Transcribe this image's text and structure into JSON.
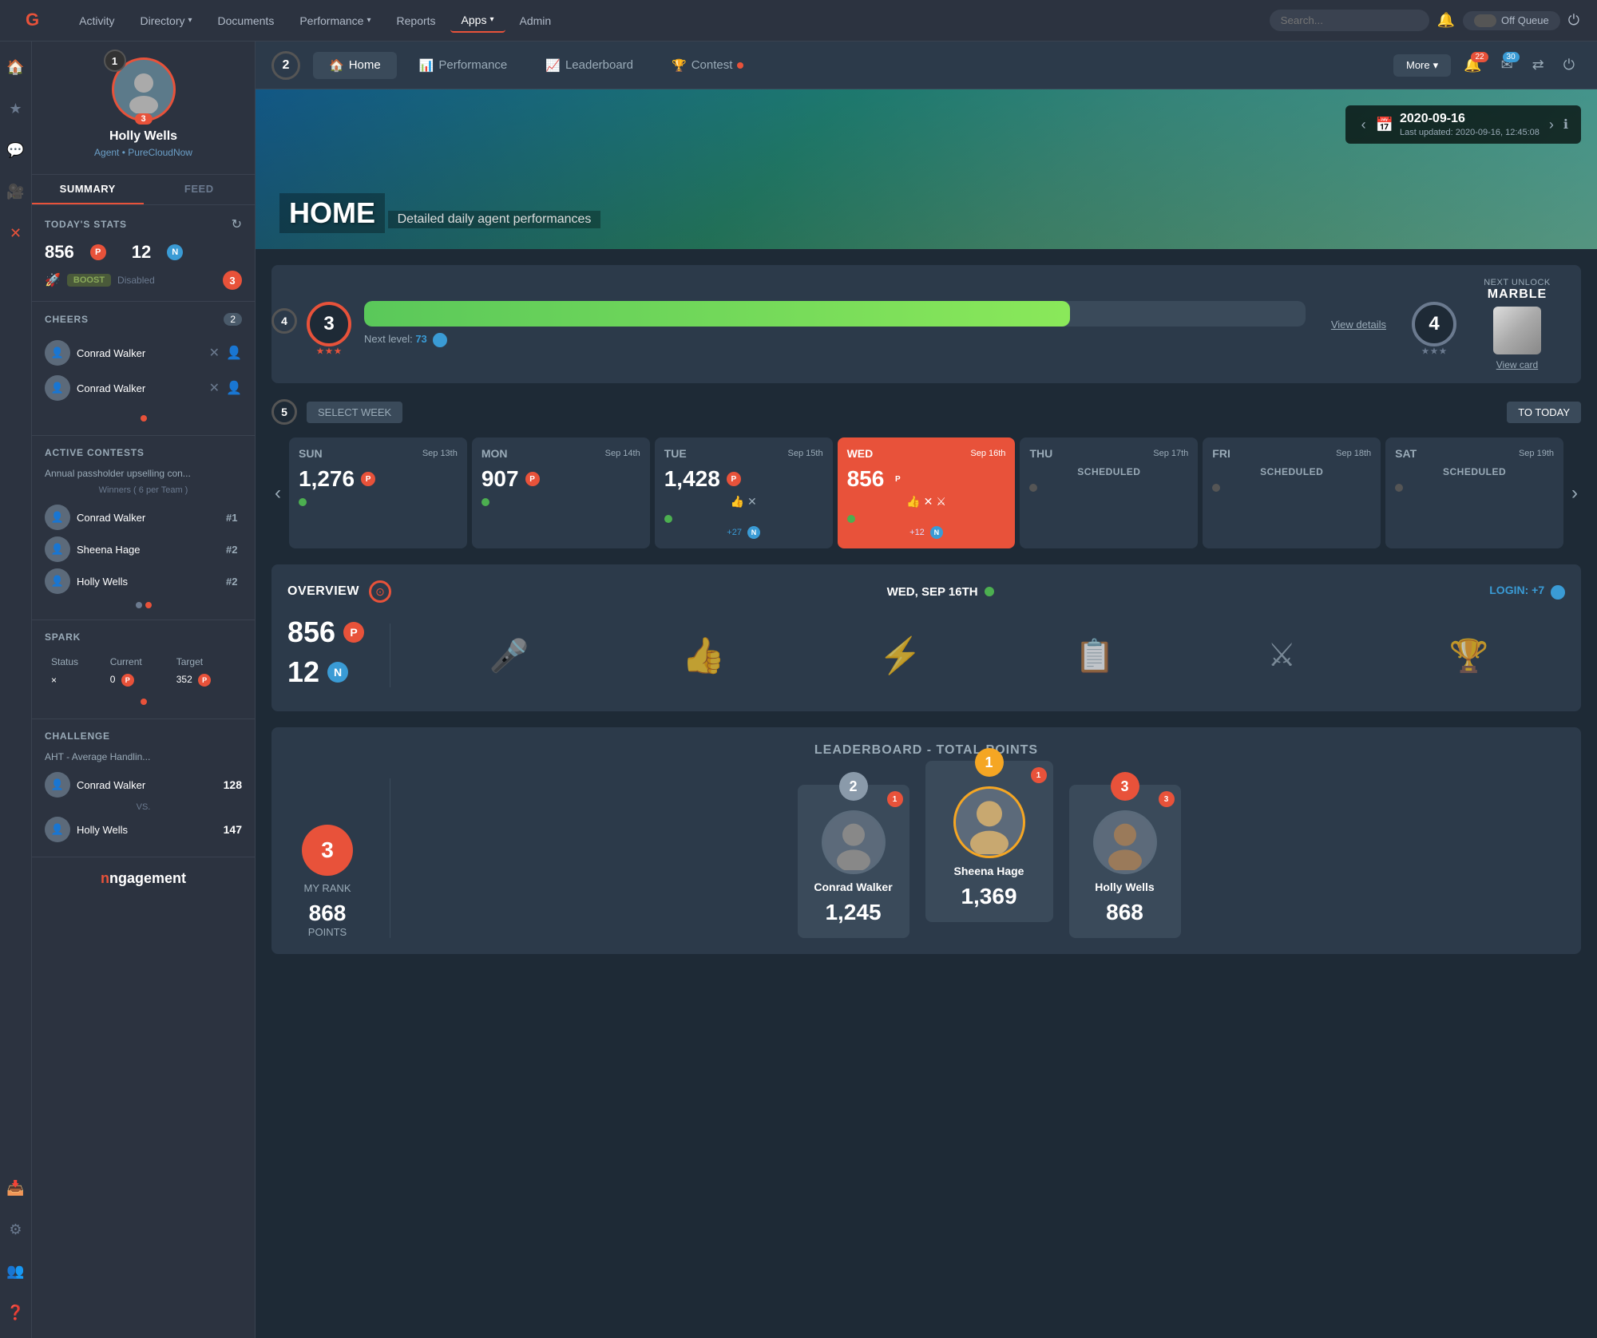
{
  "topNav": {
    "logo": "G",
    "items": [
      {
        "label": "Activity",
        "active": false
      },
      {
        "label": "Directory",
        "active": false,
        "hasChevron": true
      },
      {
        "label": "Documents",
        "active": false
      },
      {
        "label": "Performance",
        "active": false,
        "hasChevron": true
      },
      {
        "label": "Reports",
        "active": false
      },
      {
        "label": "Apps",
        "active": true,
        "hasChevron": true
      },
      {
        "label": "Admin",
        "active": false
      }
    ],
    "searchPlaceholder": "Search...",
    "queueLabel": "Off Queue",
    "notifCount": "22",
    "mailCount": "30"
  },
  "leftSidebar": {
    "icons": [
      "home",
      "star",
      "chat",
      "video",
      "ban",
      "inbox",
      "settings",
      "user-group",
      "question"
    ]
  },
  "userPanel": {
    "stepNum": "1",
    "name": "Holly Wells",
    "role": "Agent • PureCloudNow",
    "level": "3",
    "tabs": [
      "SUMMARY",
      "FEED"
    ],
    "activeTab": "SUMMARY",
    "todaysStats": {
      "title": "TODAY'S STATS",
      "points": "856",
      "nPoints": "12",
      "boostLabel": "BOOST",
      "boostStatus": "Disabled",
      "boostNum": "3"
    },
    "cheers": {
      "title": "CHEERS",
      "count": "2",
      "items": [
        {
          "name": "Conrad Walker"
        },
        {
          "name": "Conrad Walker"
        }
      ]
    },
    "activeContests": {
      "title": "ACTIVE CONTESTS",
      "name": "Annual passholder upselling con...",
      "winnersLabel": "Winners ( 6 per Team )",
      "ranks": [
        {
          "name": "Conrad Walker",
          "rank": "#1"
        },
        {
          "name": "Sheena Hage",
          "rank": "#2"
        },
        {
          "name": "Holly Wells",
          "rank": "#2"
        }
      ]
    },
    "spark": {
      "title": "SPARK",
      "status": "×",
      "current": "0",
      "target": "352",
      "currentLabel": "Current",
      "targetLabel": "Target",
      "statusLabel": "Status"
    },
    "challenge": {
      "title": "CHALLENGE",
      "name": "AHT - Average Handlin...",
      "players": [
        {
          "name": "Conrad Walker",
          "score": "128"
        },
        {
          "name": "Holly Wells",
          "score": "147"
        }
      ]
    },
    "brand": "ngagement"
  },
  "secondNav": {
    "stepNum": "2",
    "tabs": [
      {
        "label": "Home",
        "icon": "🏠",
        "active": true
      },
      {
        "label": "Performance",
        "icon": "📊",
        "active": false
      },
      {
        "label": "Leaderboard",
        "icon": "📈",
        "active": false
      },
      {
        "label": "Contest",
        "icon": "🏆",
        "active": false
      }
    ],
    "moreLabel": "More",
    "notifCount": "22",
    "mailCount": "30"
  },
  "hero": {
    "title": "HOME",
    "subtitle": "Detailed daily agent performances",
    "date": "2020-09-16",
    "lastUpdated": "Last updated: 2020-09-16, 12:45:08"
  },
  "levelProgress": {
    "stepNum4": "4",
    "currentLevel": "3",
    "nextLevel": "4",
    "nextLevelPoints": "73",
    "progressPercent": 75,
    "viewDetailsLabel": "View details",
    "nextUnlockLabel": "NEXT UNLOCK",
    "nextUnlockItem": "MARBLE",
    "viewCardLabel": "View card"
  },
  "weekSelector": {
    "stepNum5": "5",
    "selectWeekLabel": "SELECT WEEK",
    "toTodayLabel": "TO TODAY",
    "days": [
      {
        "name": "SUN",
        "date": "Sep 13th",
        "points": "1,276",
        "hasDot": true,
        "dotColor": "green",
        "active": false,
        "status": null,
        "bonus": null
      },
      {
        "name": "MON",
        "date": "Sep 14th",
        "points": "907",
        "hasDot": true,
        "dotColor": "green",
        "active": false,
        "status": null,
        "bonus": null
      },
      {
        "name": "TUE",
        "date": "Sep 15th",
        "points": "1,428",
        "hasDot": true,
        "dotColor": "green",
        "active": false,
        "status": null,
        "bonus": "+27",
        "hasActions": true
      },
      {
        "name": "WED",
        "date": "Sep 16th",
        "points": "856",
        "hasDot": true,
        "dotColor": "green",
        "active": true,
        "status": null,
        "bonus": "+12",
        "hasActions": true
      },
      {
        "name": "THU",
        "date": "Sep 17th",
        "points": null,
        "hasDot": false,
        "dotColor": "gray",
        "active": false,
        "status": "SCHEDULED",
        "bonus": null
      },
      {
        "name": "FRI",
        "date": "Sep 18th",
        "points": null,
        "hasDot": false,
        "dotColor": "gray",
        "active": false,
        "status": "SCHEDULED",
        "bonus": null
      },
      {
        "name": "SAT",
        "date": "Sep 19th",
        "points": null,
        "hasDot": false,
        "dotColor": "gray",
        "active": false,
        "status": "SCHEDULED",
        "bonus": null
      }
    ]
  },
  "overview": {
    "title": "OVERVIEW",
    "date": "WED, SEP 16TH",
    "loginLabel": "LOGIN:",
    "loginBonus": "+7",
    "points": "856",
    "nPoints": "12",
    "icons": [
      "👍",
      "⚡",
      "📋",
      "⚔",
      "🏆"
    ]
  },
  "leaderboard": {
    "title": "LEADERBOARD - TOTAL POINTS",
    "myRank": "3",
    "myPoints": "868",
    "myPointsLabel": "POINTS",
    "myRankLabel": "MY RANK",
    "players": [
      {
        "rank": 2,
        "name": "Conrad Walker",
        "score": "1,245",
        "rankLabel": "2",
        "badge": "1"
      },
      {
        "rank": 1,
        "name": "Sheena Hage",
        "score": "1,369",
        "rankLabel": "1",
        "badge": "1"
      },
      {
        "rank": 3,
        "name": "Holly Wells",
        "score": "868",
        "rankLabel": "3",
        "badge": "3"
      }
    ]
  }
}
